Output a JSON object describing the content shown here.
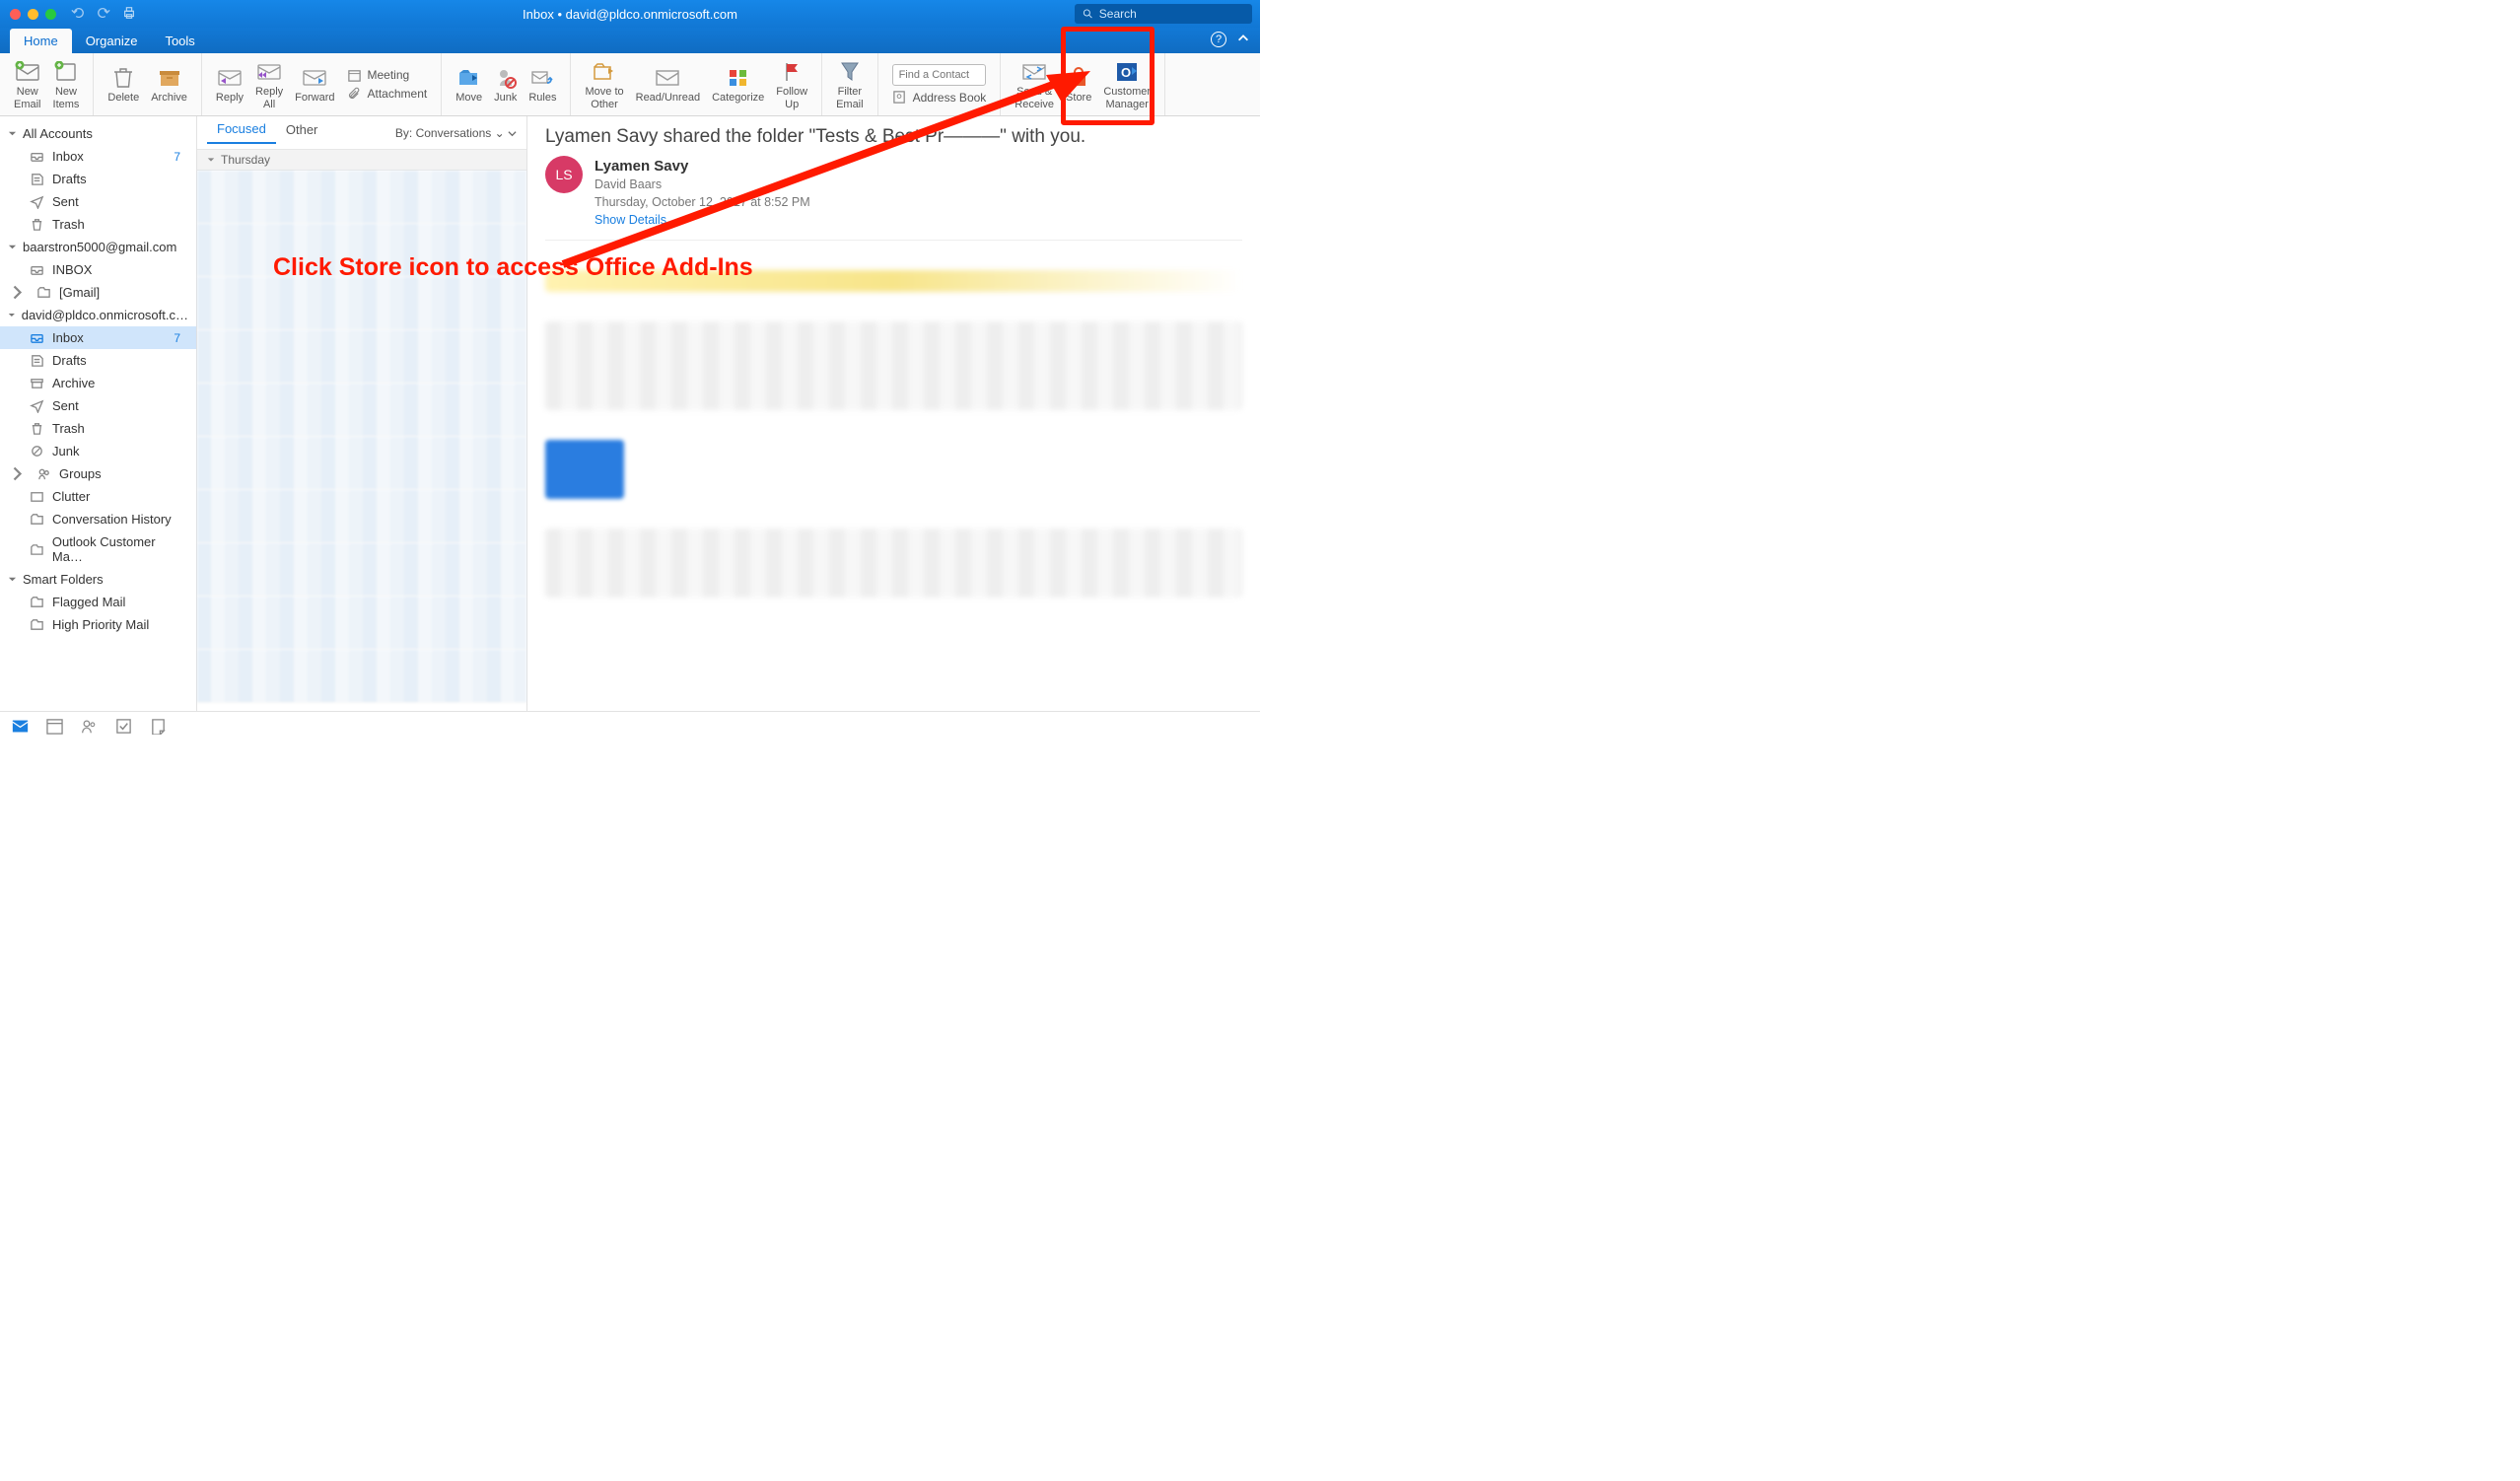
{
  "title": "Inbox • david@pldco.onmicrosoft.com",
  "search": {
    "placeholder": "Search"
  },
  "tabs": {
    "home": "Home",
    "organize": "Organize",
    "tools": "Tools"
  },
  "ribbon": {
    "new_email": "New\nEmail",
    "new_items": "New\nItems",
    "delete": "Delete",
    "archive": "Archive",
    "reply": "Reply",
    "reply_all": "Reply\nAll",
    "forward": "Forward",
    "meeting": "Meeting",
    "attachment": "Attachment",
    "move": "Move",
    "junk": "Junk",
    "rules": "Rules",
    "move_other": "Move to\nOther",
    "read_unread": "Read/Unread",
    "categorize": "Categorize",
    "follow_up": "Follow\nUp",
    "filter_email": "Filter\nEmail",
    "find_contact_ph": "Find a Contact",
    "address_book": "Address Book",
    "send_receive": "Send &\nReceive",
    "store": "Store",
    "cust_mgr": "Customer\nManager"
  },
  "nav": {
    "all_accounts": "All Accounts",
    "items1": [
      {
        "label": "Inbox",
        "count": "7"
      },
      {
        "label": "Drafts"
      },
      {
        "label": "Sent"
      },
      {
        "label": "Trash"
      }
    ],
    "gmail_hd": "baarstron5000@gmail.com",
    "gmail_items": [
      {
        "label": "INBOX"
      },
      {
        "label": "[Gmail]",
        "expand": true
      }
    ],
    "pldco_hd": "david@pldco.onmicrosoft.c…",
    "pldco_items": [
      {
        "label": "Inbox",
        "count": "7",
        "sel": true
      },
      {
        "label": "Drafts"
      },
      {
        "label": "Archive"
      },
      {
        "label": "Sent"
      },
      {
        "label": "Trash"
      },
      {
        "label": "Junk"
      },
      {
        "label": "Groups",
        "expand": true
      },
      {
        "label": "Clutter"
      },
      {
        "label": "Conversation History"
      },
      {
        "label": "Outlook Customer Ma…"
      }
    ],
    "smart_hd": "Smart Folders",
    "smart_items": [
      {
        "label": "Flagged Mail"
      },
      {
        "label": "High Priority Mail"
      }
    ]
  },
  "mlist": {
    "focused": "Focused",
    "other": "Other",
    "sortby": "By: Conversations ⌄",
    "day": "Thursday"
  },
  "reader": {
    "subject": "Lyamen Savy shared the folder \"Tests & Best Pr———\" with you.",
    "initials": "LS",
    "from_name": "Lyamen Savy",
    "to_name": "David Baars",
    "date": "Thursday, October 12, 2017 at 8:52 PM",
    "show_details": "Show Details"
  },
  "annotation": {
    "text": "Click Store icon to access Office Add-Ins"
  }
}
